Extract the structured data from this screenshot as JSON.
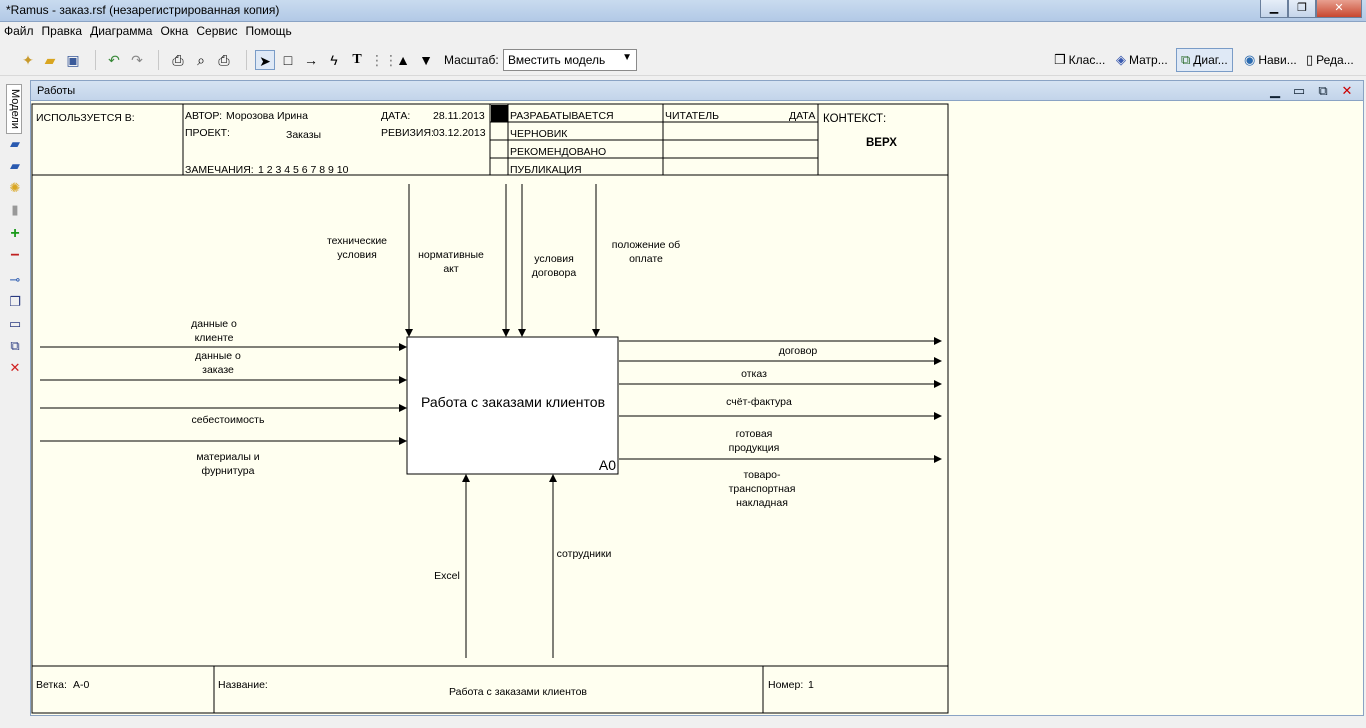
{
  "window": {
    "title": "*Ramus - заказ.rsf (незарегистрированная копия)"
  },
  "menu": [
    "Файл",
    "Правка",
    "Диаграмма",
    "Окна",
    "Сервис",
    "Помощь"
  ],
  "toolbar": {
    "zoom_label": "Масштаб:",
    "zoom_value": "Вместить модель",
    "views": [
      "Клас...",
      "Матр...",
      "Диаг...",
      "Нави...",
      "Реда..."
    ]
  },
  "sidebar": {
    "tab_label": "Модели"
  },
  "panel": {
    "title": "Работы"
  },
  "header": {
    "used_in": "ИСПОЛЬЗУЕТСЯ В:",
    "author_label": "АВТОР:",
    "author": "Морозова Ирина",
    "project_label": "ПРОЕКТ:",
    "project": "Заказы",
    "date_label": "ДАТА:",
    "date": "28.11.2013",
    "revision_label": "РЕВИЗИЯ:",
    "revision": "03.12.2013",
    "notes_label": "ЗАМЕЧАНИЯ:",
    "notes": "1 2 3 4 5 6 7 8 9 10",
    "status": [
      "РАЗРАБАТЫВАЕТСЯ",
      "ЧЕРНОВИК",
      "РЕКОМЕНДОВАНО",
      "ПУБЛИКАЦИЯ"
    ],
    "reader": "ЧИТАТЕЛЬ",
    "reader_date": "ДАТА",
    "context": "КОНТЕКСТ:",
    "context_value": "ВЕРХ"
  },
  "activity": {
    "name": "Работа с заказами клиентов",
    "number": "A0"
  },
  "controls": [
    "технические\nусловия",
    "нормативные\nакт",
    "условия\nдоговора",
    "положение об\nоплате"
  ],
  "inputs": [
    "данные о\nклиенте",
    "данные о\nзаказе",
    "себестоимость",
    "материалы и\nфурнитура"
  ],
  "outputs": [
    "договор",
    "отказ",
    "счёт-фактура",
    "готовая\nпродукция",
    "товаро-\nтранспортная\nнакладная"
  ],
  "mechanisms": [
    "Excel",
    "сотрудники"
  ],
  "footer": {
    "branch_label": "Ветка:",
    "branch": "A-0",
    "name_label": "Название:",
    "name": "Работа с заказами клиентов",
    "number_label": "Номер:",
    "number": "1"
  }
}
